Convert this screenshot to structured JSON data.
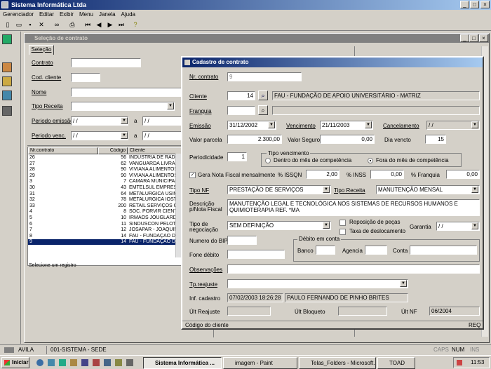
{
  "app": {
    "title": "Sistema Informática Ltda"
  },
  "menu": [
    "Gerenciador",
    "Editar",
    "Exibir",
    "Menu",
    "Janela",
    "Ajuda"
  ],
  "sel": {
    "title": "Seleção de contrato",
    "tab": "Seleção",
    "contrato": "Contrato",
    "cod_cliente": "Cod. cliente",
    "nome": "Nome",
    "tipo_receita": "Tipo Receita",
    "periodo_emissao": "Periodo emissão",
    "periodo_venc": "Periodo venc.",
    "a": "a",
    "date_ph": "/  /",
    "col1": "Nr.contrato",
    "col2": "Código",
    "col3": "Cliente",
    "status": "Selecione um registro",
    "rows": [
      [
        "26",
        "56",
        "INDUSTRIA DE RADIA"
      ],
      [
        "27",
        "62",
        "VANGUARDA LIVRAR"
      ],
      [
        "28",
        "90",
        "VIVIANA ALIMENTOS"
      ],
      [
        "29",
        "90",
        "VIVIANA ALIMENTOS"
      ],
      [
        "3",
        "7",
        "CAMARA MUNICIPAL"
      ],
      [
        "30",
        "43",
        "EMTELSUL EMPRESA"
      ],
      [
        "31",
        "64",
        "METALURGICA USIME"
      ],
      [
        "32",
        "78",
        "METALURGICA IOST I"
      ],
      [
        "33",
        "200",
        "RETAIL SERVIÇOS CO"
      ],
      [
        "4",
        "8",
        "SOC. PORVIR CIENTÍ"
      ],
      [
        "5",
        "10",
        "IRMÃOS JOUGLARD L"
      ],
      [
        "6",
        "11",
        "SINDUSCON PELOTA"
      ],
      [
        "7",
        "12",
        "JOSAPAR - JOAQUIM"
      ],
      [
        "8",
        "14",
        "FAU - FUNDAÇÃO DE"
      ],
      [
        "9",
        "14",
        "FAU - FUNDAÇÃO DE"
      ]
    ]
  },
  "cad": {
    "title": "Cadastro de contrato",
    "nr_contrato_lbl": "Nr. contrato",
    "nr_contrato": "9",
    "cliente_lbl": "Cliente",
    "cliente_cod": "14",
    "cliente_nome": "FAU - FUNDAÇÃO DE APOIO UNIVERSITÁRIO - MATRIZ",
    "franquia_lbl": "Franquia",
    "emissao_lbl": "Emissão",
    "emissao": "31/12/2002",
    "vencimento_lbl": "Vencimento",
    "vencimento": "21/11/2003",
    "cancelamento_lbl": "Cancelamento",
    "cancelamento": "/  /",
    "valor_parcela_lbl": "Valor parcela",
    "valor_parcela": "2.300,00",
    "valor_seguro_lbl": "Valor Seguro",
    "valor_seguro": "0,00",
    "dia_vencto_lbl": "Dia vencto",
    "dia_vencto": "15",
    "periodicidade_lbl": "Periodicidade",
    "periodicidade": "1",
    "tipo_venc_lbl": "Tipo vencimento",
    "tv1": "Dentro do mês de competência",
    "tv2": "Fora do mês de competência",
    "gera_nf": "Gera Nota Fiscal mensalmente",
    "issqn_lbl": "% ISSQN",
    "issqn": "2,00",
    "inss_lbl": "% INSS",
    "inss": "0,00",
    "franq_lbl": "% Franquia",
    "franq": "0,00",
    "tipo_nf_lbl": "Tipo NF",
    "tipo_nf": "PRESTAÇÃO DE SERVIÇOS",
    "tipo_receita_lbl": "Tipo Receita",
    "tipo_receita": "MANUTENÇÃO MENSAL",
    "descricao_lbl1": "Descrição",
    "descricao_lbl2": "p/Nota Fiscal",
    "descricao1": "MANUTENÇÃO LEGAL E TECNOLÓGICA NOS SISTEMAS DE RECURSOS HUMANOS E",
    "descricao2": "QUIMIOTERAPIA REF. *MA",
    "tipo_neg_lbl1": "Tipo de",
    "tipo_neg_lbl2": "negociação",
    "tipo_neg": "SEM DEFINIÇÃO",
    "repos": "Reposição de peças",
    "taxa": "Taxa de deslocamento",
    "garantia_lbl": "Garantia",
    "garantia": "/  /",
    "bip_lbl": "Numero do BIP",
    "fone_lbl": "Fone débito",
    "debito_lbl": "Débito em conta",
    "banco_lbl": "Banco",
    "agencia_lbl": "Agencia",
    "conta_lbl": "Conta",
    "obs_lbl": "Observações",
    "reajuste_lbl": "Tp.reajuste",
    "inf_lbl": "Inf. cadastro",
    "inf_data": "07/02/2003 18:26:28",
    "inf_user": "PAULO FERNANDO DE PINHO BRITES",
    "ult_reajuste_lbl": "Últ Reajuste",
    "ult_bloqueto_lbl": "Últ Bloqueto",
    "ult_nf_lbl": "Últ NF",
    "ult_nf": "06/2004",
    "status": "Código do cliente",
    "req": "REQ"
  },
  "statusbar": {
    "user": "AVILA",
    "system": "001-SISTEMA - SEDE",
    "caps": "CAPS",
    "num": "NUM",
    "ins": "INS"
  },
  "taskbar": {
    "start": "Iniciar",
    "t1": "Sistema Informática ...",
    "t2": "imagem - Paint",
    "t3": "Telas_Folders - Microsoft...",
    "t4": "TOAD",
    "clock": "11:53"
  }
}
